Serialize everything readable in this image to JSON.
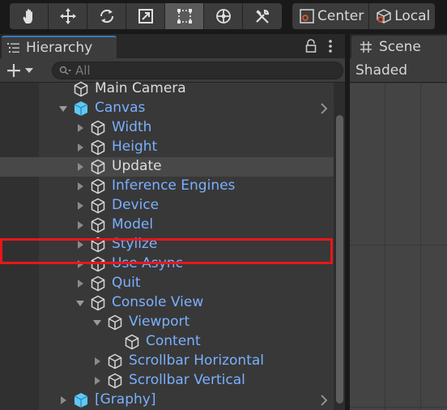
{
  "toolbar": {
    "tools": [
      {
        "name": "hand-tool",
        "icon": "hand-icon",
        "active": false
      },
      {
        "name": "move-tool",
        "icon": "move-icon",
        "active": false
      },
      {
        "name": "rotate-tool",
        "icon": "rotate-icon",
        "active": false
      },
      {
        "name": "scale-tool",
        "icon": "scale-icon",
        "active": false
      },
      {
        "name": "rect-tool",
        "icon": "rect-icon",
        "active": true
      },
      {
        "name": "transform-tool",
        "icon": "transform-icon",
        "active": false
      },
      {
        "name": "custom-tool",
        "icon": "tools-icon",
        "active": false
      }
    ],
    "pivot_mode_label": "Center",
    "pivot_space_label": "Local"
  },
  "hierarchy": {
    "tab_label": "Hierarchy",
    "add_icon": "plus-icon",
    "search_placeholder": "All",
    "items": [
      {
        "label": "Main Camera",
        "depth": 0,
        "expand": "none",
        "color": "white",
        "prefab": false,
        "chevron": false
      },
      {
        "label": "Canvas",
        "depth": 0,
        "expand": "open",
        "color": "blue",
        "prefab": true,
        "chevron": true
      },
      {
        "label": "Width",
        "depth": 1,
        "expand": "closed",
        "color": "blue",
        "prefab": false,
        "chevron": false
      },
      {
        "label": "Height",
        "depth": 1,
        "expand": "closed",
        "color": "blue",
        "prefab": false,
        "chevron": false
      },
      {
        "label": "Update",
        "depth": 1,
        "expand": "closed",
        "color": "white",
        "prefab": false,
        "chevron": false,
        "selected": true
      },
      {
        "label": "Inference Engines",
        "depth": 1,
        "expand": "closed",
        "color": "blue",
        "prefab": false,
        "chevron": false
      },
      {
        "label": "Device",
        "depth": 1,
        "expand": "closed",
        "color": "blue",
        "prefab": false,
        "chevron": false
      },
      {
        "label": "Model",
        "depth": 1,
        "expand": "closed",
        "color": "blue",
        "prefab": false,
        "chevron": false
      },
      {
        "label": "Stylize",
        "depth": 1,
        "expand": "closed",
        "color": "blue",
        "prefab": false,
        "chevron": false
      },
      {
        "label": "Use Async",
        "depth": 1,
        "expand": "closed",
        "color": "blue",
        "prefab": false,
        "chevron": false
      },
      {
        "label": "Quit",
        "depth": 1,
        "expand": "closed",
        "color": "blue",
        "prefab": false,
        "chevron": false
      },
      {
        "label": "Console View",
        "depth": 1,
        "expand": "open",
        "color": "blue",
        "prefab": false,
        "chevron": false
      },
      {
        "label": "Viewport",
        "depth": 2,
        "expand": "open",
        "color": "blue",
        "prefab": false,
        "chevron": false
      },
      {
        "label": "Content",
        "depth": 3,
        "expand": "none",
        "color": "blue",
        "prefab": false,
        "chevron": false
      },
      {
        "label": "Scrollbar Horizontal",
        "depth": 2,
        "expand": "closed",
        "color": "blue",
        "prefab": false,
        "chevron": false
      },
      {
        "label": "Scrollbar Vertical",
        "depth": 2,
        "expand": "closed",
        "color": "blue",
        "prefab": false,
        "chevron": false
      },
      {
        "label": "[Graphy]",
        "depth": 0,
        "expand": "closed",
        "color": "blue",
        "prefab": true,
        "chevron": true
      }
    ]
  },
  "scene": {
    "tab_label": "Scene",
    "shading_mode": "Shaded"
  },
  "colors": {
    "accent_tab": "#3a79bb",
    "label_blue": "#7ab0ff",
    "highlight_red": "#e8161c",
    "prefab_cube": "#5ec8f4"
  }
}
